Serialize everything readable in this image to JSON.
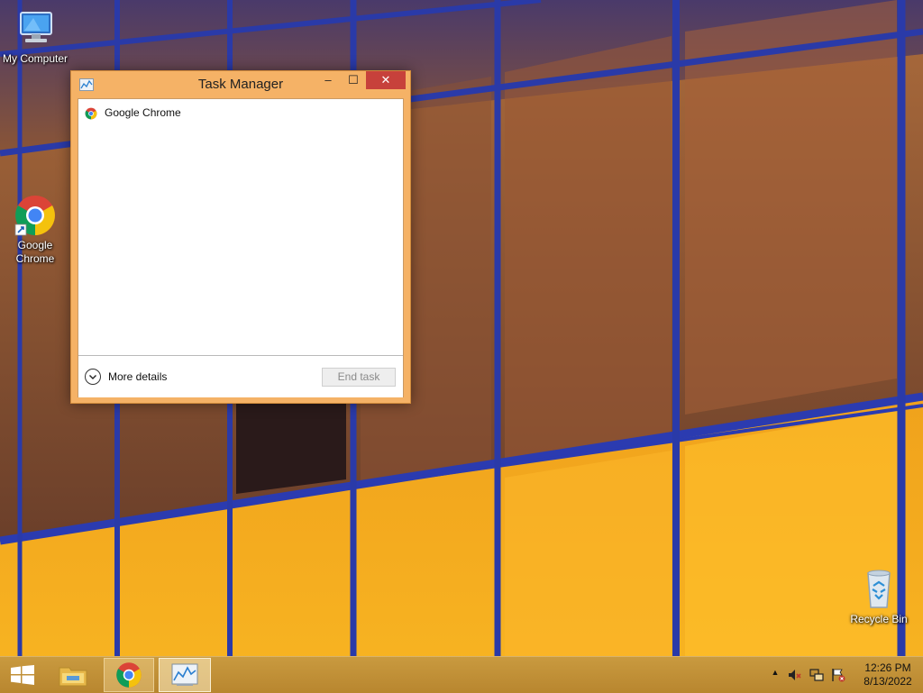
{
  "desktop": {
    "icons": {
      "my_computer": "My Computer",
      "chrome_line1": "Google",
      "chrome_line2": "Chrome",
      "recycle_bin": "Recycle Bin"
    }
  },
  "task_manager": {
    "title": "Task Manager",
    "caption_buttons": {
      "minimize": "‒",
      "maximize": "☐",
      "close": "✕"
    },
    "processes": [
      {
        "name": "Google Chrome",
        "icon": "chrome-icon"
      }
    ],
    "more_details_label": "More details",
    "end_task_label": "End task",
    "end_task_enabled": false
  },
  "taskbar": {
    "pinned": [
      "start-icon",
      "file-explorer-icon",
      "chrome-icon",
      "task-manager-icon"
    ],
    "active": "task-manager-icon"
  },
  "tray": {
    "icons": [
      "show-hidden-icons-chevron",
      "volume-muted-icon",
      "network-icon",
      "action-center-flag-icon"
    ],
    "chevron": "▲",
    "time": "12:26 PM",
    "date": "8/13/2022"
  },
  "colors": {
    "window_frame": "#f5b266",
    "close_button": "#c7413b",
    "taskbar": "#c0903a"
  }
}
